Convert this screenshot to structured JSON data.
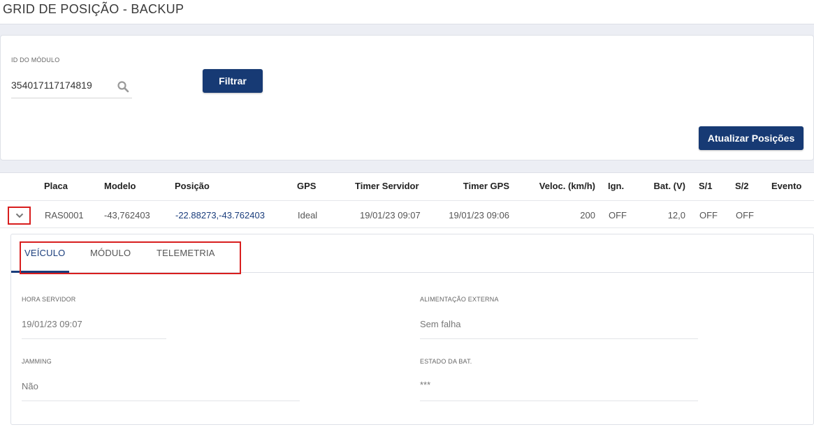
{
  "page": {
    "title": "GRID DE POSIÇÃO - BACKUP"
  },
  "filter": {
    "module_id_label": "ID DO MÓDULO",
    "module_id_value": "354017117174819",
    "filter_button": "Filtrar",
    "refresh_button": "Atualizar Posições"
  },
  "grid": {
    "columns": [
      "Placa",
      "Modelo",
      "Posição",
      "GPS",
      "Timer Servidor",
      "Timer GPS",
      "Veloc. (km/h)",
      "Ign.",
      "Bat. (V)",
      "S/1",
      "S/2",
      "Evento"
    ],
    "row": {
      "placa": "RAS0001",
      "modelo": "-43,762403",
      "posicao": "-22.88273,-43.762403",
      "gps": "Ideal",
      "timer_servidor": "19/01/23 09:07",
      "timer_gps": "19/01/23 09:06",
      "velocidade": "200",
      "ignicao": "OFF",
      "bateria": "12,0",
      "s1": "OFF",
      "s2": "OFF",
      "evento": ""
    }
  },
  "details": {
    "tabs": [
      "VEÍCULO",
      "MÓDULO",
      "TELEMETRIA"
    ],
    "active_tab": "VEÍCULO",
    "fields": {
      "hora_servidor_label": "HORA SERVIDOR",
      "hora_servidor_value": "19/01/23 09:07",
      "jamming_label": "JAMMING",
      "jamming_value": "Não",
      "alimentacao_label": "ALIMENTAÇÃO EXTERNA",
      "alimentacao_value": "Sem falha",
      "estado_bat_label": "ESTADO DA BAT.",
      "estado_bat_value": "***"
    }
  },
  "icons": {
    "search": "search-icon",
    "expand": "chevron-down-icon"
  },
  "colors": {
    "primary": "#173a74",
    "highlight": "#d81e1e",
    "link": "#1a3d7c"
  }
}
